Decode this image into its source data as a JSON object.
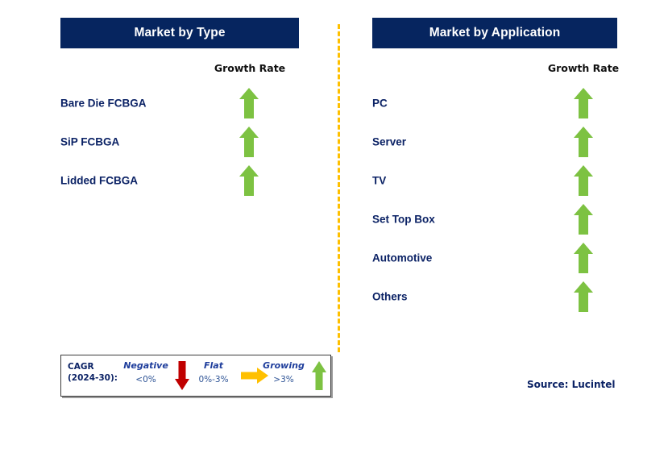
{
  "colors": {
    "header_bg": "#06255F",
    "header_text": "#FFFFFF",
    "label_navy": "#0B2265",
    "arrow_green": "#7DC242",
    "arrow_red": "#C00000",
    "arrow_orange": "#FFC000",
    "divider_orange": "#FFC000",
    "legend_border": "#3B3B3B"
  },
  "panels": [
    {
      "id": "left",
      "title": "Market by Type",
      "growth_rate_label": "Growth Rate",
      "rows": [
        {
          "label": "Bare Die FCBGA",
          "trend": "growing",
          "trend_icon": "arrow-up-icon"
        },
        {
          "label": "SiP FCBGA",
          "trend": "growing",
          "trend_icon": "arrow-up-icon"
        },
        {
          "label": "Lidded FCBGA",
          "trend": "growing",
          "trend_icon": "arrow-up-icon"
        }
      ]
    },
    {
      "id": "right",
      "title": "Market by Application",
      "growth_rate_label": "Growth Rate",
      "rows": [
        {
          "label": "PC",
          "trend": "growing",
          "trend_icon": "arrow-up-icon"
        },
        {
          "label": "Server",
          "trend": "growing",
          "trend_icon": "arrow-up-icon"
        },
        {
          "label": "TV",
          "trend": "growing",
          "trend_icon": "arrow-up-icon"
        },
        {
          "label": "Set Top Box",
          "trend": "growing",
          "trend_icon": "arrow-up-icon"
        },
        {
          "label": "Automotive",
          "trend": "growing",
          "trend_icon": "arrow-up-icon"
        },
        {
          "label": "Others",
          "trend": "growing",
          "trend_icon": "arrow-up-icon"
        }
      ]
    }
  ],
  "legend": {
    "title_line1": "CAGR",
    "title_line2": "(2024-30):",
    "items": [
      {
        "term": "Negative",
        "range": "<0%",
        "icon": "arrow-down-icon",
        "color": "#C00000"
      },
      {
        "term": "Flat",
        "range": "0%-3%",
        "icon": "arrow-right-icon",
        "color": "#FFC000"
      },
      {
        "term": "Growing",
        "range": ">3%",
        "icon": "arrow-up-icon",
        "color": "#7DC242"
      }
    ]
  },
  "source": "Source: Lucintel"
}
